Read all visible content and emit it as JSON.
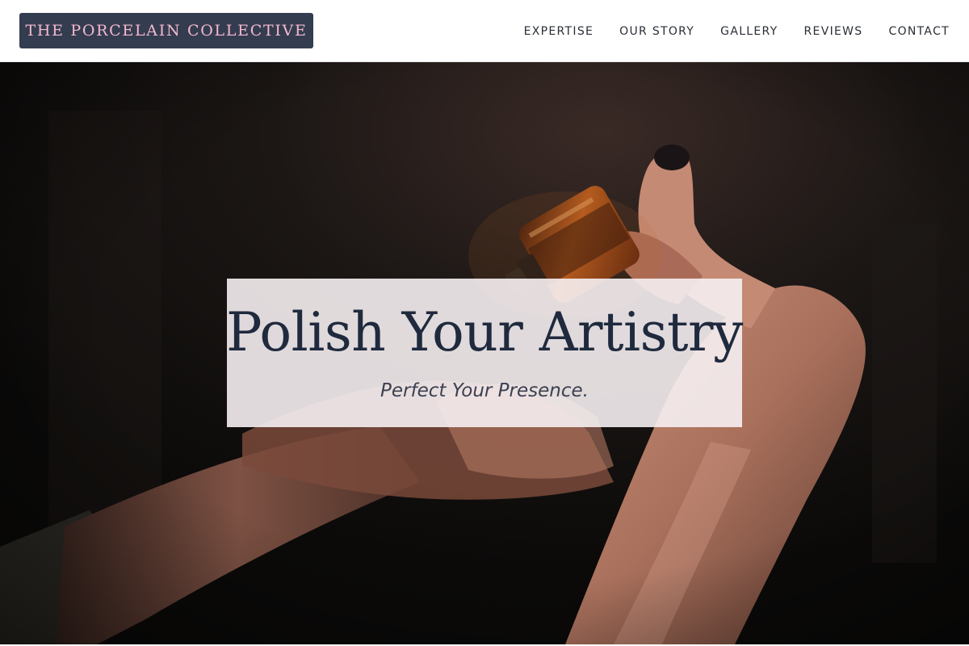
{
  "brand": {
    "name": "THE PORCELAIN COLLECTIVE"
  },
  "nav": {
    "items": [
      {
        "label": "EXPERTISE"
      },
      {
        "label": "OUR STORY"
      },
      {
        "label": "GALLERY"
      },
      {
        "label": "REVIEWS"
      },
      {
        "label": "CONTACT"
      }
    ]
  },
  "hero": {
    "title": "Polish Your Artistry",
    "subtitle": "Perfect Your Presence.",
    "image_subject": "hands holding a small amber glass bottle against a dark background"
  },
  "colors": {
    "brand_background": "#343d4f",
    "brand_text": "#f5b8d0",
    "title_text": "#1f2a3e",
    "card_background": "#f6f0f2"
  }
}
